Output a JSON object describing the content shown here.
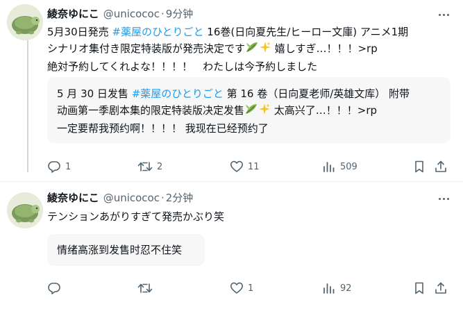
{
  "tweets": [
    {
      "author": {
        "name": "綾奈ゆにこ",
        "handle": "@unicococ",
        "separator": "·",
        "time": "9分钟"
      },
      "text_lines": [
        {
          "before": "5月30日発売 ",
          "hashtag": "#薬屋のひとりごと",
          "after": " 16巻(日向夏先生/ヒーロー文庫) アニメ1期"
        },
        {
          "before": "シナリオ集付き限定特装版が発売決定です",
          "after": "  嬉しすぎ…！！！>rp"
        },
        {
          "before": "絶対予約してくれよな！！！！　わたしは今予約しました"
        }
      ],
      "translation_lines": [
        {
          "before": "5 月 30 日发售 ",
          "hashtag": "#薬屋のひとりごと",
          "after": " 第 16 卷（日向夏老师/英雄文库） 附带"
        },
        {
          "before": "动画第一季剧本集的限定特装版决定发售",
          "after": "  太高兴了…！！！>rp"
        },
        {
          "before": "一定要帮我预约啊！！！！ 我现在已经预约了"
        }
      ],
      "stats": {
        "replies": "1",
        "retweets": "2",
        "likes": "11",
        "views": "509"
      }
    },
    {
      "author": {
        "name": "綾奈ゆにこ",
        "handle": "@unicococ",
        "separator": "·",
        "time": "2分钟"
      },
      "text_lines": [
        {
          "before": "テンションあがりすぎて発売かぶり笑"
        }
      ],
      "translation_lines": [
        {
          "before": "情绪高涨到发售时忍不住笑"
        }
      ],
      "stats": {
        "replies": "",
        "retweets": "",
        "likes": "1",
        "views": "92"
      }
    }
  ],
  "icons": [
    "reply-icon",
    "retweet-icon",
    "like-icon",
    "views-icon",
    "bookmark-icon",
    "share-icon",
    "more-icon",
    "leaf-emoji-icon",
    "sparkles-emoji-icon"
  ],
  "colors": {
    "hashtag": "#1d9bf0",
    "secondary_text": "#536471",
    "translation_bg": "#f7f7f7"
  }
}
